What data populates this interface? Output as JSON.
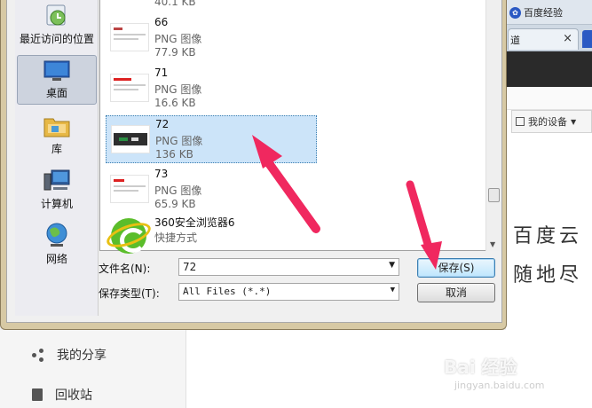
{
  "browser": {
    "tab1_label": "百度经验",
    "tab2_label": "道",
    "tab2_close": "×",
    "device_button": "我的设备",
    "device_dropdown": "▼",
    "hand_line1": "百度云",
    "hand_line2": "随地尽"
  },
  "sidebar": {
    "share_label": "我的分享",
    "recycle_label": "回收站"
  },
  "nav": {
    "items": [
      {
        "label": "最近访问的位置",
        "icon": "recent-places-icon"
      },
      {
        "label": "桌面",
        "icon": "desktop-icon",
        "selected": true
      },
      {
        "label": "库",
        "icon": "libraries-icon"
      },
      {
        "label": "计算机",
        "icon": "computer-icon"
      },
      {
        "label": "网络",
        "icon": "network-icon"
      }
    ]
  },
  "files": {
    "top_partial_size": "40.1 KB",
    "items": [
      {
        "name": "66",
        "type": "PNG 图像",
        "size": "77.9 KB"
      },
      {
        "name": "71",
        "type": "PNG 图像",
        "size": "16.6 KB"
      },
      {
        "name": "72",
        "type": "PNG 图像",
        "size": "136 KB",
        "selected": true
      },
      {
        "name": "73",
        "type": "PNG 图像",
        "size": "65.9 KB"
      },
      {
        "name": "360安全浏览器6",
        "type": "快捷方式",
        "size": ""
      }
    ]
  },
  "form": {
    "filename_label": "文件名(N):",
    "filename_value": "72",
    "filetype_label": "保存类型(T):",
    "filetype_value": "All Files (*.*)",
    "save_button": "保存(S)",
    "cancel_button": "取消"
  },
  "watermark": {
    "brand": "Bai 经验",
    "url": "jingyan.baidu.com"
  },
  "colors": {
    "annotation_arrow": "#f0285f",
    "selection": "#cce4f9"
  }
}
